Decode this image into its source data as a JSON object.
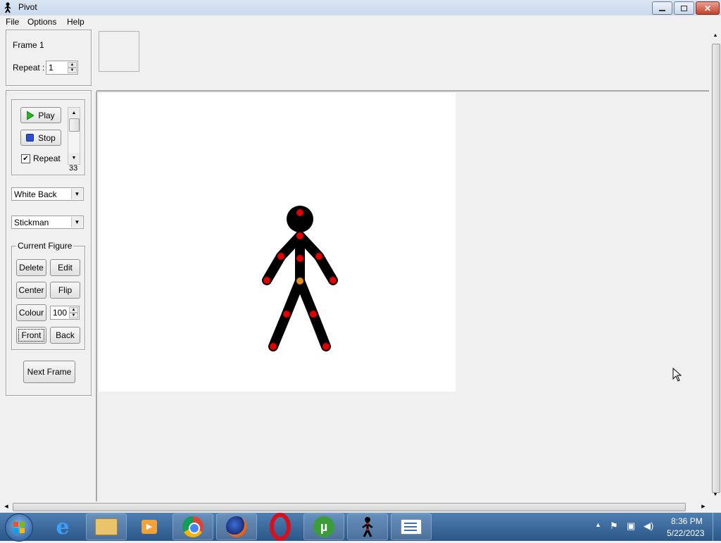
{
  "window": {
    "title": "Pivot",
    "app_icon": "stickman-icon",
    "controls": [
      "minimize-icon",
      "restore-icon",
      "close-icon"
    ]
  },
  "menu": {
    "items": [
      "File",
      "Options",
      "Help"
    ]
  },
  "frame_panel": {
    "frame_label": "Frame 1",
    "repeat_label": "Repeat :",
    "repeat_value": "1"
  },
  "playback": {
    "play_label": "Play",
    "stop_label": "Stop",
    "repeat_label": "Repeat",
    "repeat_checked": true,
    "speed_value": "33"
  },
  "background_select": {
    "selected": "White Back"
  },
  "figure_select": {
    "selected": "Stickman"
  },
  "current_figure": {
    "group_label": "Current Figure",
    "delete_label": "Delete",
    "edit_label": "Edit",
    "center_label": "Center",
    "flip_label": "Flip",
    "colour_label": "Colour",
    "colour_value": "100",
    "front_label": "Front",
    "back_label": "Back"
  },
  "next_frame_label": "Next Frame",
  "colors": {
    "joint": "#e00000",
    "anchor_joint": "#e08a1e",
    "figure": "#000000",
    "canvas": "#ffffff"
  },
  "taskbar": {
    "start": "windows-start-icon",
    "apps": [
      "internet-explorer-icon",
      "file-explorer-icon",
      "media-player-icon",
      "chrome-icon",
      "firefox-icon",
      "opera-icon",
      "utorrent-icon",
      "pivot-stickman-icon",
      "task-list-icon"
    ],
    "time": "8:36 PM",
    "date": "5/22/2023"
  }
}
